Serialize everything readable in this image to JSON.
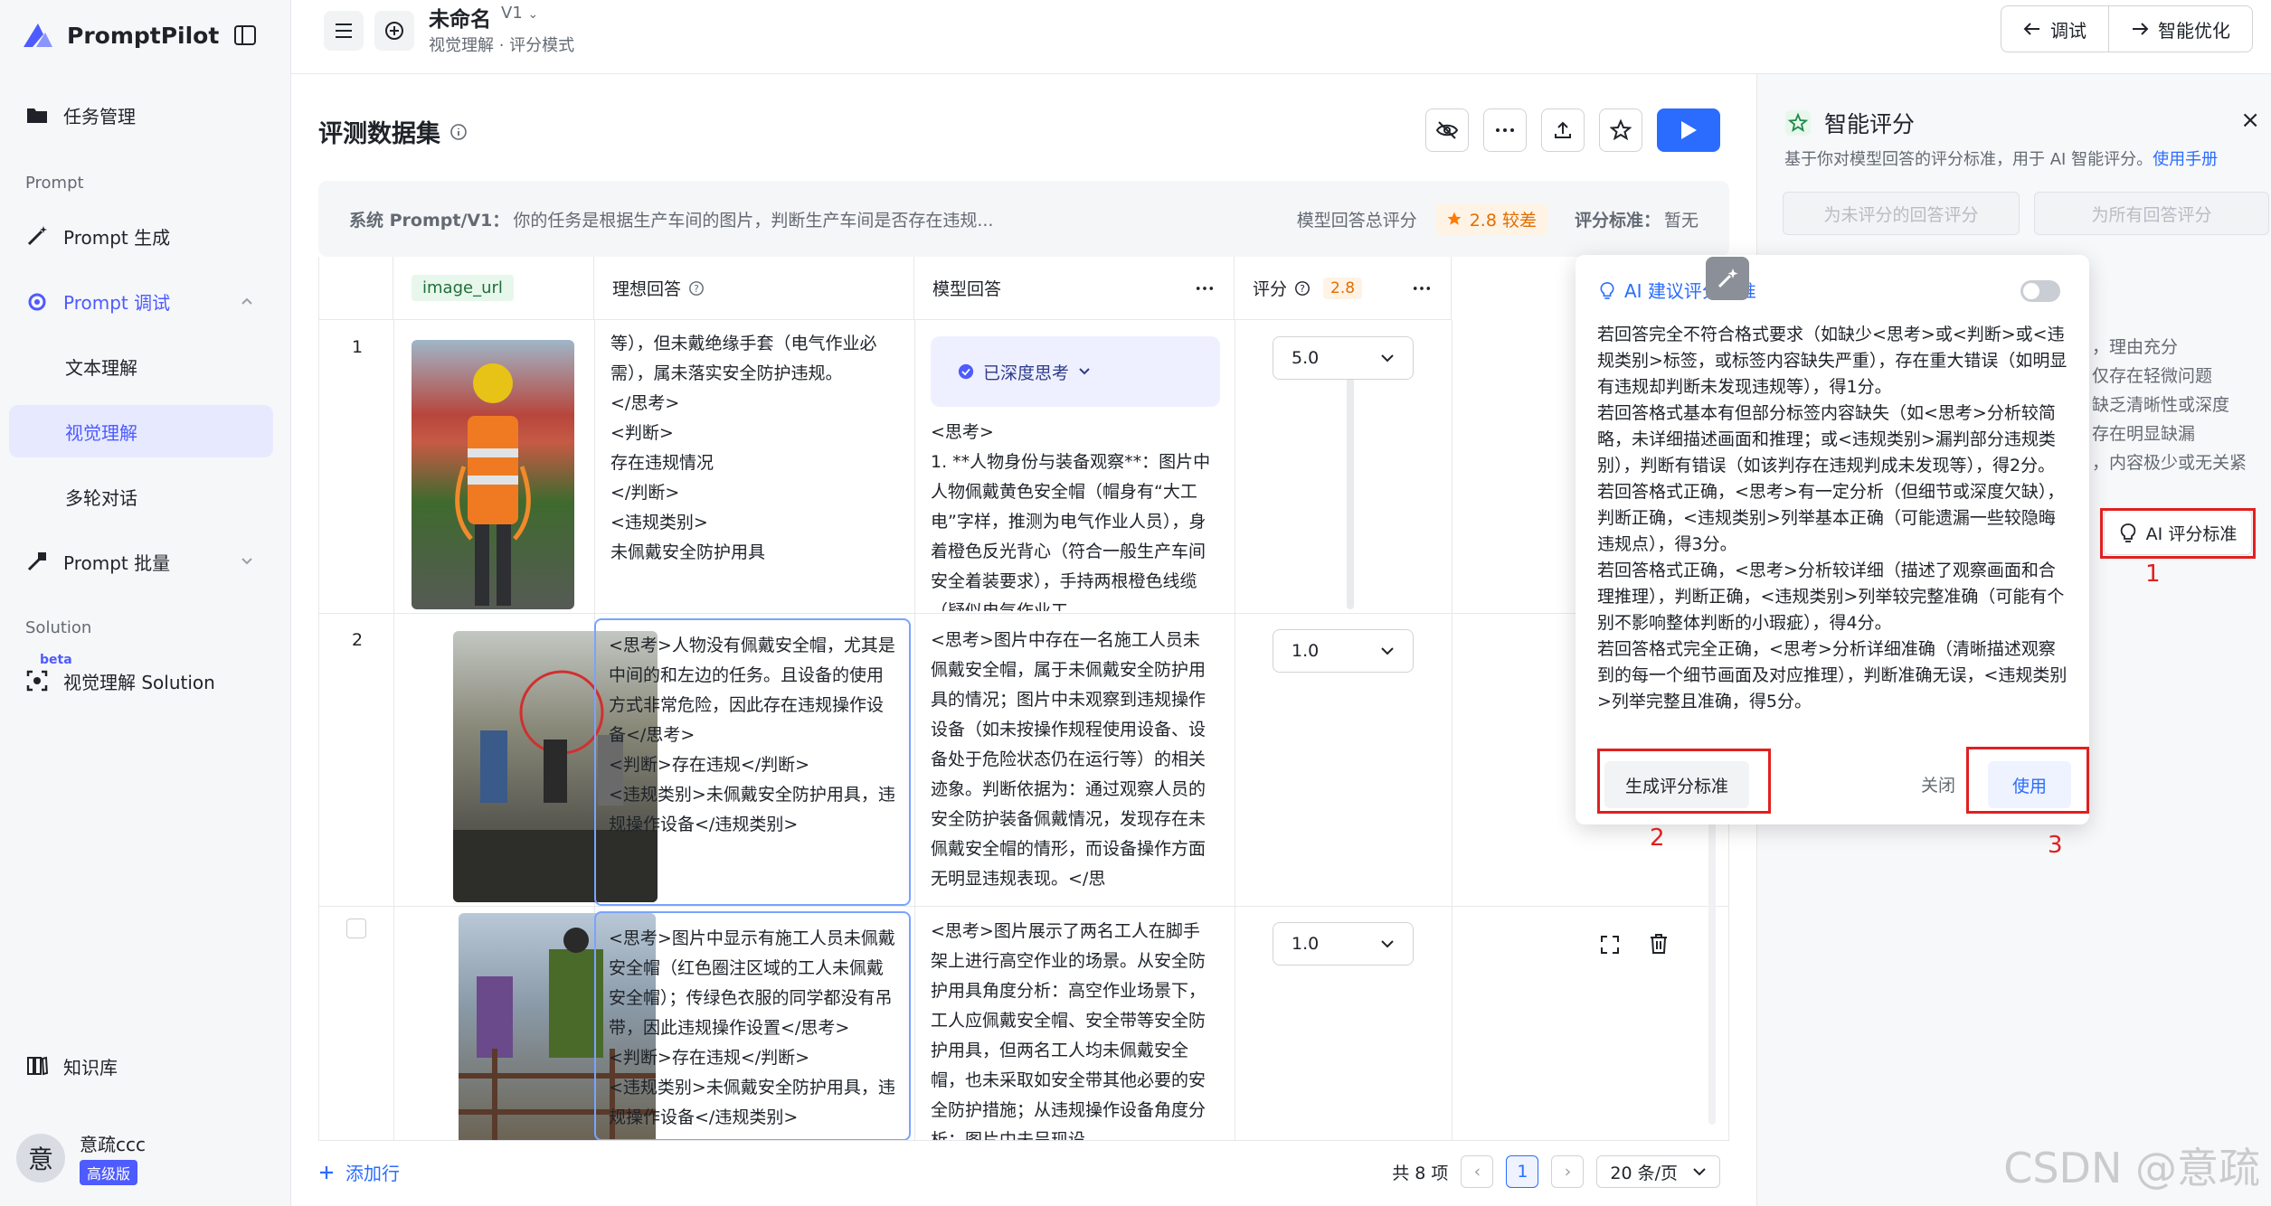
{
  "app": {
    "name": "PromptPilot"
  },
  "sidebar": {
    "items": [
      {
        "label": "任务管理"
      },
      {
        "label": "Prompt 生成"
      },
      {
        "label": "Prompt 调试"
      },
      {
        "label": "文本理解"
      },
      {
        "label": "视觉理解"
      },
      {
        "label": "多轮对话"
      },
      {
        "label": "Prompt 批量"
      },
      {
        "label": "视觉理解 Solution"
      },
      {
        "label": "知识库"
      }
    ],
    "groups": {
      "prompt": "Prompt",
      "solution": "Solution"
    },
    "beta": "beta",
    "user": {
      "avatar": "意",
      "name": "意疏ccc",
      "badge": "高级版"
    }
  },
  "header": {
    "title": "未命名",
    "version": "V1",
    "breadcrumb": "视觉理解 · 评分模式",
    "debug": "调试",
    "optimize": "智能优化"
  },
  "main": {
    "section_title": "评测数据集",
    "system_label": "系统 Prompt/V1：",
    "system_text": "你的任务是根据生产车间的图片，判断生产车间是否存在违规...",
    "total_label": "模型回答总评分",
    "total_score": "2.8 较差",
    "std_label": "评分标准：",
    "std_value": "暂无",
    "columns": {
      "image": "image_url",
      "ideal": "理想回答",
      "model": "模型回答",
      "score": "评分",
      "score_avg": "2.8"
    },
    "rows": [
      {
        "index": "1",
        "ideal": "等），但未戴绝缘手套（电气作业必需），属未落实安全防护违规。\n</思考>\n<判断>\n存在违规情况\n</判断>\n<违规类别>\n未佩戴安全防护用具",
        "deep_label": "已深度思考",
        "model": "<思考>\n1. **人物身份与装备观察**：图片中人物佩戴黄色安全帽（帽身有“大工电”字样，推测为电气作业人员），身着橙色反光背心（符合一般生产车间安全着装要求），手持两根橙色线缆（疑似电气作业工",
        "score": "5.0"
      },
      {
        "index": "2",
        "ideal": "<思考>人物没有佩戴安全帽，尤其是中间的和左边的任务。且设备的使用方式非常危险，因此存在违规操作设备</思考>\n<判断>存在违规</判断>\n<违规类别>未佩戴安全防护用具，违规操作设备</违规类别>",
        "model": "<思考>图片中存在一名施工人员未佩戴安全帽，属于未佩戴安全防护用具的情况；图片中未观察到违规操作设备（如未按操作规程使用设备、设备处于危险状态仍在运行等）的相关迹象。判断依据为：通过观察人员的安全防护装备佩戴情况，发现存在未佩戴安全帽的情形，而设备操作方面无明显违规表现。</思",
        "score": "1.0"
      },
      {
        "index": "",
        "ideal": "<思考>图片中显示有施工人员未佩戴安全帽（红色圈注区域的工人未佩戴安全帽）；传绿色衣服的同学都没有吊带，因此违规操作设置</思考>\n<判断>存在违规</判断>\n<违规类别>未佩戴安全防护用具，违规操作设备</违规类别>",
        "model": "<思考>图片展示了两名工人在脚手架上进行高空作业的场景。从安全防护用具角度分析：高空作业场景下，工人应佩戴安全帽、安全带等安全防护用具，但两名工人均未佩戴安全帽，也未采取如安全带其他必要的安全防护措施；从违规操作设备角度分析：图片中未呈现设",
        "score": "1.0"
      }
    ],
    "add_row": "添加行",
    "total_items": "共 8 项",
    "page": "1",
    "page_size": "20 条/页"
  },
  "rpanel": {
    "title": "智能评分",
    "desc": "基于你对模型回答的评分标准，用于 AI 智能评分。",
    "manual": "使用手册",
    "btn_unscored": "为未评分的回答评分",
    "btn_all": "为所有回答评分",
    "bg_lines": [
      "，理由充分",
      "仅存在轻微问题",
      "缺乏清晰性或深度",
      "存在明显缺漏",
      "，内容极少或无关紧"
    ],
    "ai_std": "AI 评分标准"
  },
  "popover": {
    "title": "AI 建议评分标准",
    "body": "若回答完全不符合格式要求（如缺少<思考>或<判断>或<违规类别>标签，或标签内容缺失严重），存在重大错误（如明显有违规却判断未发现违规等），得1分。\n若回答格式基本有但部分标签内容缺失（如<思考>分析较简略，未详细描述画面和推理；或<违规类别>漏判部分违规类别），判断有错误（如该判存在违规判成未发现等），得2分。\n若回答格式正确，<思考>有一定分析（但细节或深度欠缺），判断正确，<违规类别>列举基本正确（可能遗漏一些较隐晦违规点），得3分。\n若回答格式正确，<思考>分析较详细（描述了观察画面和合理推理），判断正确，<违规类别>列举较完整准确（可能有个别不影响整体判断的小瑕疵），得4分。\n若回答格式完全正确，<思考>分析详细准确（清晰描述观察到的每一个细节画面及对应推理），判断准确无误，<违规类别>列举完整且准确，得5分。",
    "generate": "生成评分标准",
    "close": "关闭",
    "use": "使用"
  },
  "annotations": [
    "1",
    "2",
    "3"
  ],
  "watermark": "CSDN @意疏",
  "colors": {
    "accent": "#2b6cff",
    "brand": "#4d5bff",
    "annotation": "#e02020"
  }
}
